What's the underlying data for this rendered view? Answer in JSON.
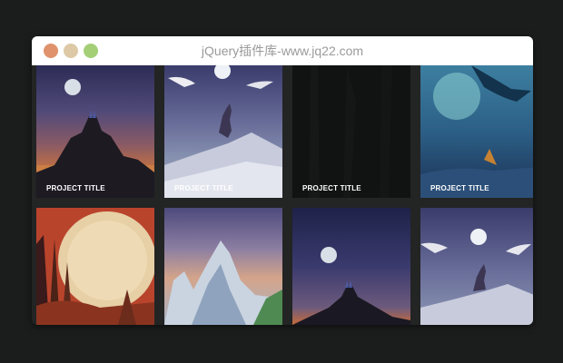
{
  "window": {
    "title": "jQuery插件库-www.jq22.com",
    "controls": {
      "close_color": "#e0926c",
      "minimize_color": "#ddc9a6",
      "maximize_color": "#a4cf77"
    }
  },
  "gallery": {
    "cards": [
      {
        "title": "PROJECT TITLE",
        "scene": "mountain-castle-moon-sunset"
      },
      {
        "title": "PROJECT TITLE",
        "scene": "wolf-howling-moon-snow"
      },
      {
        "title": "PROJECT TITLE",
        "scene": "dark-forest"
      },
      {
        "title": "PROJECT TITLE",
        "scene": "blue-whale-underwater"
      },
      {
        "title": "",
        "scene": "big-moon-red-forest"
      },
      {
        "title": "",
        "scene": "snowy-peaks-dusk"
      },
      {
        "title": "",
        "scene": "moon-castle-night"
      },
      {
        "title": "",
        "scene": "wolf-moon-night"
      }
    ]
  }
}
